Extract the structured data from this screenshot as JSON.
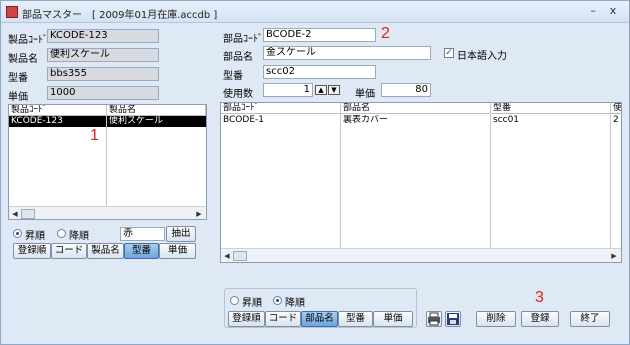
{
  "window": {
    "title": "部品マスター　[ 2009年01月在庫.accdb ]",
    "minimize": "–",
    "close": "x"
  },
  "left_form": {
    "product_code_label": "製品ｺｰﾄﾞ",
    "product_code_value": "KCODE-123",
    "product_name_label": "製品名",
    "product_name_value": "便利スケール",
    "model_label": "型番",
    "model_value": "bbs355",
    "price_label": "単価",
    "price_value": "1000"
  },
  "left_list": {
    "headers": [
      "製品ｺｰﾄﾞ",
      "製品名"
    ],
    "rows": [
      [
        "KCODE-123",
        "便利スケール"
      ]
    ]
  },
  "left_controls": {
    "asc_label": "昇順",
    "desc_label": "降順",
    "filter_value": "赤",
    "extract_label": "抽出",
    "sort_buttons": [
      "登録順",
      "コード",
      "製品名",
      "型番",
      "単価"
    ]
  },
  "right_form": {
    "part_code_label": "部品ｺｰﾄﾞ",
    "part_code_value": "BCODE-2",
    "part_name_label": "部品名",
    "part_name_value": "金スケール",
    "japanese_input_label": "日本語入力",
    "model_label": "型番",
    "model_value": "scc02",
    "qty_label": "使用数",
    "qty_value": "1",
    "price_label": "単価",
    "price_value": "80"
  },
  "right_list": {
    "headers": [
      "部品ｺｰﾄﾞ",
      "部品名",
      "型番",
      "使"
    ],
    "rows": [
      [
        "BCODE-1",
        "裏表カバー",
        "scc01",
        "2"
      ]
    ]
  },
  "bottom_controls": {
    "asc_label": "昇順",
    "desc_label": "降順",
    "sort_buttons": [
      "登録順",
      "コード",
      "部品名",
      "型番",
      "単価"
    ],
    "delete_label": "削除",
    "register_label": "登録",
    "exit_label": "終了"
  },
  "annotations": {
    "n1": "1",
    "n2": "2",
    "n3": "3"
  },
  "colors": {
    "annotation": "#e0231c",
    "selection": "#000000",
    "window_bg": "#dfe9f5"
  }
}
